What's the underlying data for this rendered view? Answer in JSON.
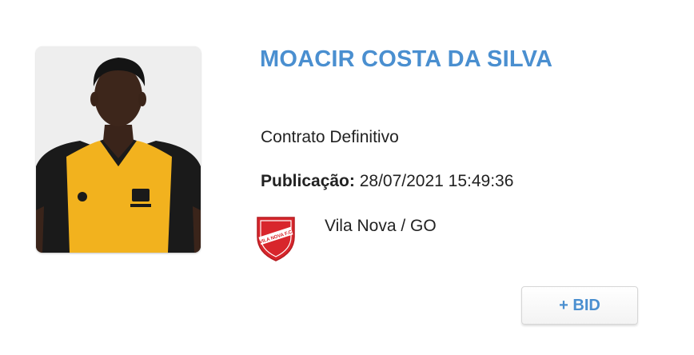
{
  "player": {
    "name": "MOACIR COSTA DA SILVA",
    "contract_type": "Contrato Definitivo",
    "publication_label": "Publicação:",
    "publication_datetime": "28/07/2021 15:49:36",
    "club": "Vila Nova / GO",
    "crest_text": "VILA NOVA F.C."
  },
  "actions": {
    "bid_label": "+ BID"
  },
  "colors": {
    "accent": "#4a8fd0",
    "crest_red": "#d8262c",
    "jersey_yellow": "#f2b21e"
  }
}
